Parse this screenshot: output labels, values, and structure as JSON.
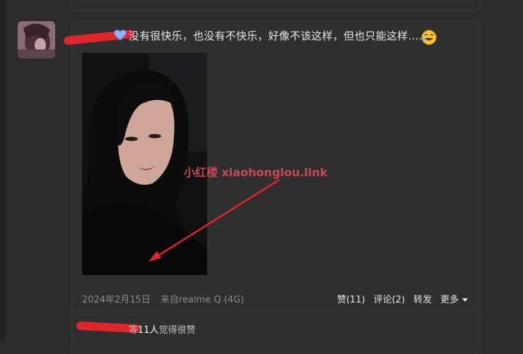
{
  "post": {
    "text": "没有很快乐，也没有不快乐，好像不该这样，但也只能这样……",
    "watermark": "小红楼  xiaohonglou.link",
    "date": "2024年2月15日",
    "source": "来自realme Q (4G)"
  },
  "actions": {
    "like": "赞(11)",
    "comment": "评论(2)",
    "repost": "转发",
    "more": "更多"
  },
  "likes_summary": {
    "prefix": "等",
    "count": "11人",
    "suffix": "觉得很赞"
  },
  "colors": {
    "redaction": "#e0252b",
    "background": "#2b2b2b",
    "card": "#2f2f2f"
  },
  "icons": [
    "avatar",
    "heart-emoji-icon",
    "laughing-emoji-icon",
    "chevron-down-icon"
  ]
}
